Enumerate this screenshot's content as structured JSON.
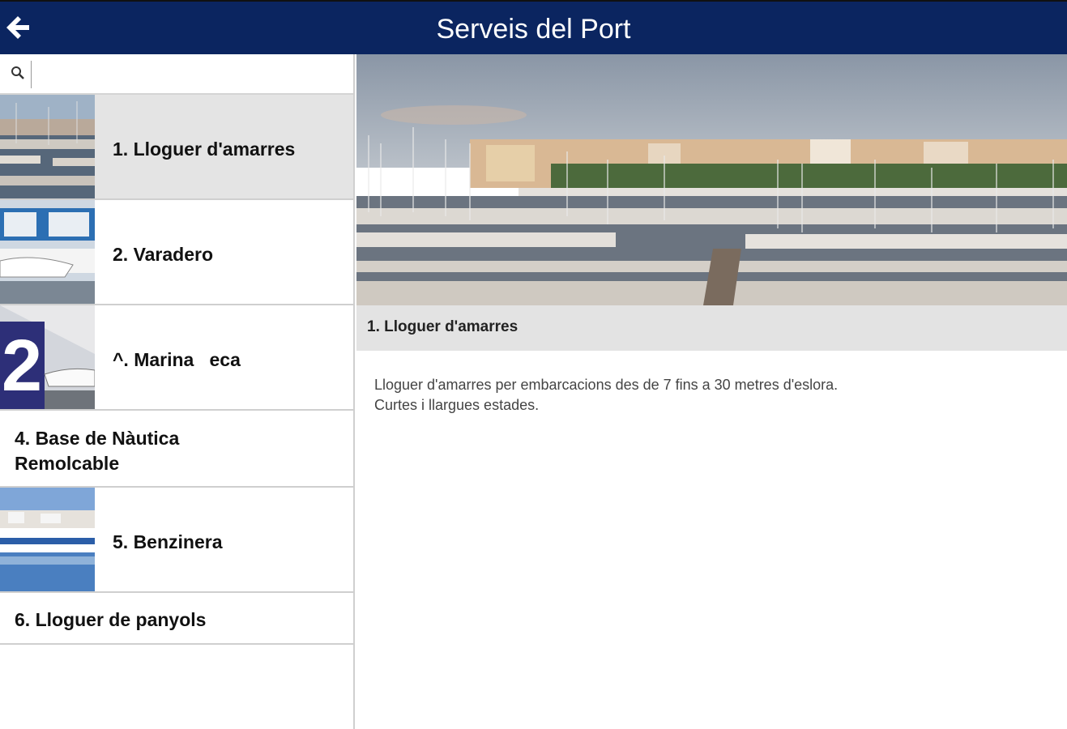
{
  "header": {
    "title": "Serveis del Port",
    "back_icon": "arrow-left-icon"
  },
  "search": {
    "icon": "search-icon",
    "value": "",
    "placeholder": ""
  },
  "services": [
    {
      "label": "1. Lloguer d'amarres",
      "selected": true,
      "thumb": "marina-boats-thumb"
    },
    {
      "label": "2. Varadero",
      "selected": false,
      "thumb": "boatyard-thumb"
    },
    {
      "label": "^. Marina   eca",
      "selected": false,
      "thumb": "dry-marina-thumb"
    },
    {
      "label_line1": "4. Base de Nàutica",
      "label_line2": "Remolcable",
      "selected": false
    },
    {
      "label": "5. Benzinera",
      "selected": false,
      "thumb": "fuel-station-thumb"
    },
    {
      "label": "6. Lloguer de panyols",
      "selected": false
    }
  ],
  "detail": {
    "title": "1. Lloguer d'amarres",
    "line1": "Lloguer d'amarres per embarcacions des de 7 fins a 30 metres d'eslora.",
    "line2": "Curtes i llargues estades."
  },
  "colors": {
    "header": "#0b2560",
    "selected_row": "#e4e4e4",
    "detail_bar": "#e3e3e3"
  }
}
